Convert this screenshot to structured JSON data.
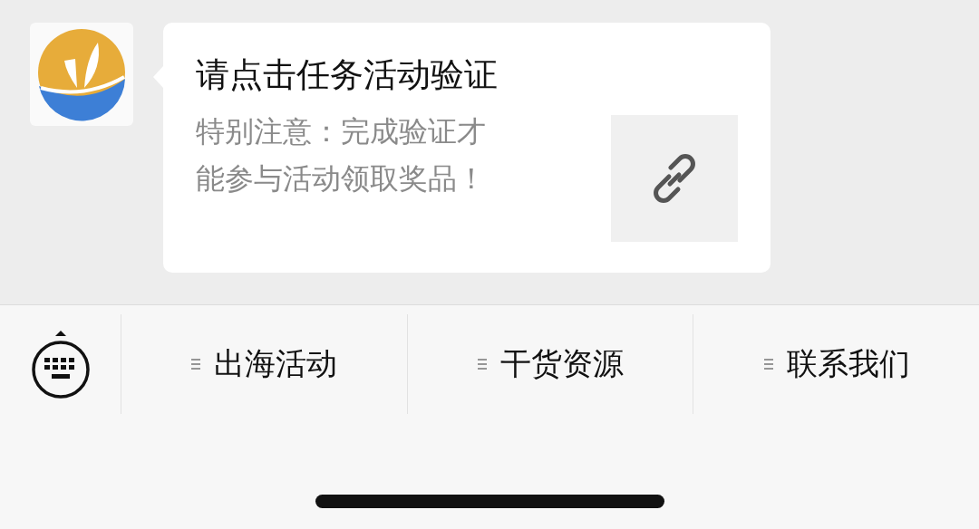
{
  "message": {
    "title": "请点击任务活动验证",
    "description": "特别注意：完成验证才能参与活动领取奖品！"
  },
  "menu_items": [
    {
      "label": "出海活动"
    },
    {
      "label": "干货资源"
    },
    {
      "label": "联系我们"
    }
  ]
}
